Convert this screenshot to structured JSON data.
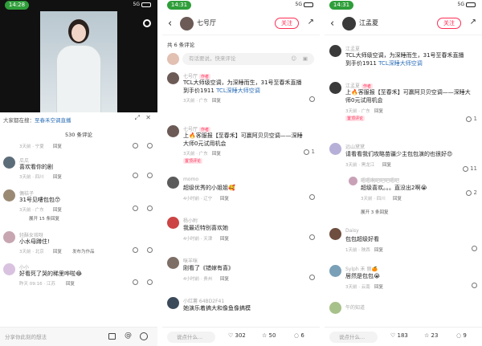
{
  "panel1": {
    "status_time": "14:28",
    "status_right": "5G",
    "search_hint_prefix": "大家都在搜：",
    "search_hint_link": "至春禾空调直播",
    "count_label": "530 条评论",
    "comments": [
      {
        "name": "",
        "text": "",
        "meta": "3天前 · 宁夏",
        "reply": "回复"
      },
      {
        "name": "瓜瓜",
        "text": "喜欢看你的剧",
        "meta": "3天前 · 四川",
        "reply": "回复"
      },
      {
        "name": "偶桔子",
        "text": "31号见嘍包包😙",
        "meta": "3天前 · 广东",
        "reply": "回复"
      },
      {
        "name": "",
        "text": "",
        "meta": "",
        "reply": "",
        "expand": "展开 15 条回复"
      },
      {
        "name": "轻酥女孩呀",
        "text": "小水母蹲住!",
        "meta": "3天前 · 北京",
        "reply": "回复",
        "extra": "发布为作品"
      },
      {
        "name": "小小",
        "text": "好看死了哭的稀里哗啦😂",
        "meta": "昨天 09:16 · 江苏",
        "reply": "回复"
      }
    ],
    "input_placeholder": "分享你此刻的想法"
  },
  "panel2": {
    "status_time": "14:31",
    "status_right": "5G",
    "header_name": "七号厅",
    "follow_label": "关注",
    "count_label": "共 6 条评论",
    "input_placeholder": "有话要说，快来评论",
    "comments": [
      {
        "name": "七号厅",
        "tag": "作者",
        "text": "TCL大师级空调，为深睡而生，31号至春禾直播到手价1911",
        "link": "TCL深睡大师空调",
        "meta": "3天前 · 广东",
        "reply": "回复"
      },
      {
        "name": "七号厅",
        "tag": "作者",
        "text": "上🔥客服报【至春禾】可赢阿贝贝空调——深睡大师0元试用机会",
        "meta": "3天前 · 广东",
        "reply": "回复",
        "like": "1",
        "cat": "置顶评论"
      },
      {
        "name": "momo",
        "text": "超级优秀的小姐姐🥰",
        "meta": "4小时前 · 辽宁",
        "reply": "回复"
      },
      {
        "name": "杨小附",
        "text": "我最近特别喜欢她",
        "meta": "4小时前 · 天津",
        "reply": "回复"
      },
      {
        "name": "咪羊咪",
        "text": "刚看了《错嫁有喜》",
        "meta": "4小时前 · 贵州",
        "reply": "回复"
      },
      {
        "name": "小红薯 64BD2F41",
        "text": "她演乐着搞大和像鱼像搞模",
        "meta": "",
        "reply": ""
      }
    ],
    "bottom_input": "说点什么...",
    "likes": "302",
    "stars": "50",
    "comments_count": "6"
  },
  "panel3": {
    "status_time": "14:31",
    "status_right": "5G",
    "header_name": "江孟夏",
    "follow_label": "关注",
    "comments": [
      {
        "name": "江孟夏",
        "text": "TCL大师级空调，为深睡而生，31号至春禾直播到手价1911",
        "link": "TCL深睡大师空调",
        "meta": "3天前 · 广东",
        "reply": "回复"
      },
      {
        "name": "江孟夏",
        "tag": "作者",
        "text": "上🔥客服报【至春禾】可赢阿贝贝空调——深睡大师0元试用机会",
        "meta": "3天前 · 广东",
        "reply": "回复",
        "like": "1",
        "cat": "置顶评论"
      },
      {
        "name": "远山黛黛",
        "text": "请看看我们攻略苗疆少主包包演的也很好😍",
        "meta": "3天前 · 黑龙江",
        "reply": "回复",
        "like": "11"
      },
      {
        "name": "嗯嗯啊吧吧吧嗯吧",
        "text": "超级喜欢。。。直没出2啊😭",
        "meta": "3天前 · 四川",
        "reply": "回复",
        "like": "2",
        "expand": "展开 3 条回复"
      },
      {
        "name": "Daisy",
        "text": "包包超级好看",
        "meta": "1天前 · 陕西",
        "reply": "回复"
      },
      {
        "name": "Sylph 禾 丽🍊",
        "text": "居然是包包😭",
        "meta": "3天前 · 云南",
        "reply": "回复"
      },
      {
        "name": "午的知道",
        "text": "",
        "meta": "",
        "reply": ""
      }
    ],
    "bottom_input": "说点什么...",
    "likes": "183",
    "stars": "23",
    "comments_count": "9"
  }
}
